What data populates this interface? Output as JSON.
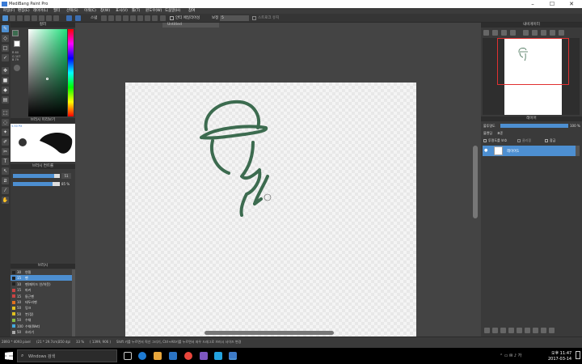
{
  "app": {
    "title": "MediBang Paint Pro"
  },
  "window": {
    "min": "–",
    "max": "☐",
    "close": "✕"
  },
  "menu": [
    "파일(F)",
    "편집(E)",
    "레이어(L)",
    "필터",
    "선택(S)",
    "이색(C)",
    "창(W)",
    "표시(V)",
    "툴(T)",
    "윈도우(W)",
    "도움말(H)",
    "참여"
  ],
  "toolbar": {
    "select_label": "스냅",
    "aa_label": "안티 에일리어싱",
    "correction_label": "보정",
    "correction_value": "5",
    "stroke_label": "스트로크 유지"
  },
  "tab": {
    "title": "Untitled"
  },
  "color_panel": {
    "title": "컬러",
    "r": "R 60",
    "g": "G 107",
    "b": "B 79"
  },
  "brush_control": {
    "title": "브러시 미리보기",
    "size_text": "5.50 PX"
  },
  "brush_settings": {
    "title": "브러시 컨트롤",
    "size_value": "51",
    "opacity_value": "85 %"
  },
  "brush_list": {
    "title": "브러시",
    "items": [
      {
        "size": "30",
        "name": "연필",
        "color": "#222222",
        "selected": false
      },
      {
        "size": "15",
        "name": "펜",
        "color": "#222222",
        "selected": true
      },
      {
        "size": "10",
        "name": "펜(페이드 인/아웃)",
        "color": "#222222",
        "selected": false
      },
      {
        "size": "15",
        "name": "마커",
        "color": "#cc4444",
        "selected": false
      },
      {
        "size": "15",
        "name": "둥근펜",
        "color": "#cc4444",
        "selected": false
      },
      {
        "size": "10",
        "name": "테두리펜",
        "color": "#e07020",
        "selected": false
      },
      {
        "size": "50",
        "name": "잉크",
        "color": "#e0c020",
        "selected": false
      },
      {
        "size": "50",
        "name": "붓(젖)",
        "color": "#e0c020",
        "selected": false
      },
      {
        "size": "50",
        "name": "수채",
        "color": "#88bb44",
        "selected": false
      },
      {
        "size": "100",
        "name": "수채(Wet)",
        "color": "#44aadd",
        "selected": false
      },
      {
        "size": "50",
        "name": "흐리기",
        "color": "#aaaaaa",
        "selected": false
      }
    ]
  },
  "navigator": {
    "title": "내비게이터"
  },
  "layer_panel": {
    "title": "레이어",
    "opacity_label": "불투명도",
    "opacity_value": "100 %",
    "blend_label": "블렌딩",
    "blend_value": "표준",
    "protect_label": "투명도를 보호",
    "clip_label": "클리핑",
    "lock_label": "잠금",
    "layer_name": "레이어1"
  },
  "status": {
    "size": "2893 * 4093 pixel",
    "paper": "(21 * 29.7cm)",
    "dpi": "350 dpi",
    "zoom": "33 %",
    "coords": "( 1399, 906 )",
    "hint": "Shift 키를 누르면서 직선 그리기, Ctrl+Alt키를 누르면서 좌우 드래그로 브러시 사이즈 변경"
  },
  "taskbar": {
    "search": "Windows 검색",
    "time": "오후 11:47",
    "date": "2017-03-14"
  },
  "colors": {
    "accent": "#4d8fd1",
    "stroke": "#3c6b4f",
    "nav_frame": "#e03030"
  }
}
